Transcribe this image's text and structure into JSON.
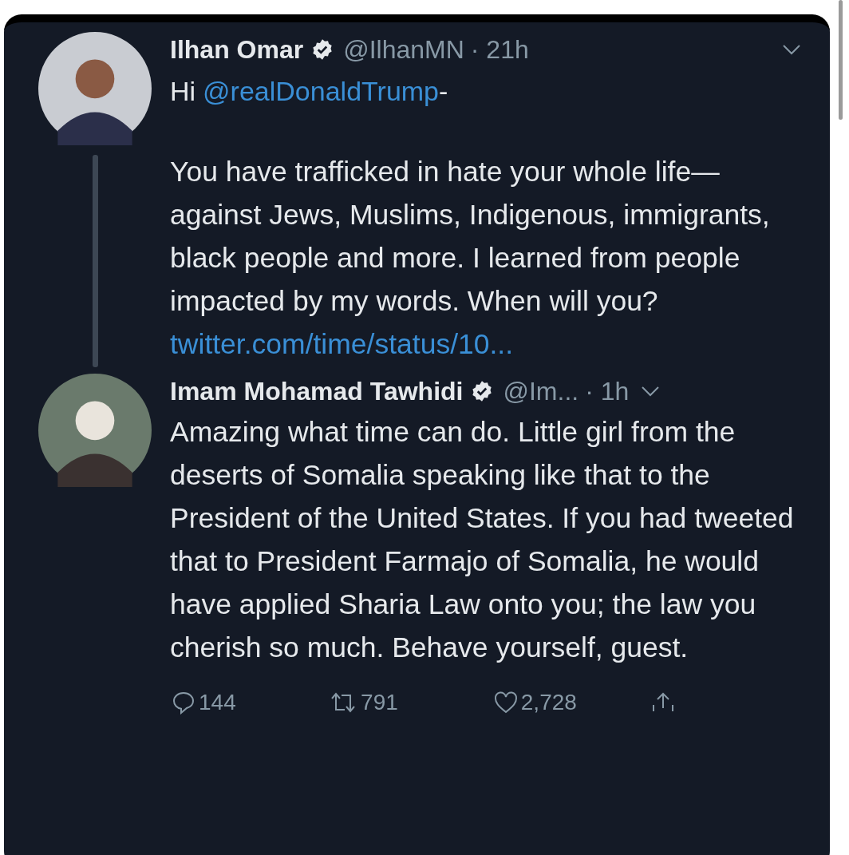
{
  "tweets": [
    {
      "name": "Ilhan Omar",
      "verified": true,
      "handle": "@IlhanMN",
      "time": "· 21h",
      "greeting": "Hi",
      "mention": "@realDonaldTrump",
      "mention_suffix": "-",
      "body": "You have trafficked in hate your whole life—against Jews, Muslims, Indigenous, immigrants, black people and more. I learned from people impacted by my words. When will you?",
      "link": "twitter.com/time/status/10...",
      "thread_line": true
    },
    {
      "name": "Imam Mohamad Tawhidi",
      "verified": true,
      "handle": "@Im...",
      "time": "· 1h",
      "body": "Amazing what time can do. Little girl from the deserts of Somalia speaking like that to the President of the United States. If you had tweeted that to President Farmajo of Somalia, he would have applied Sharia Law onto you; the law you cherish so much. Behave yourself, guest.",
      "thread_line": false,
      "actions": [
        {
          "kind": "reply",
          "count": "144"
        },
        {
          "kind": "retweet",
          "count": "791"
        },
        {
          "kind": "like",
          "count": "2,728"
        },
        {
          "kind": "share"
        }
      ]
    }
  ]
}
